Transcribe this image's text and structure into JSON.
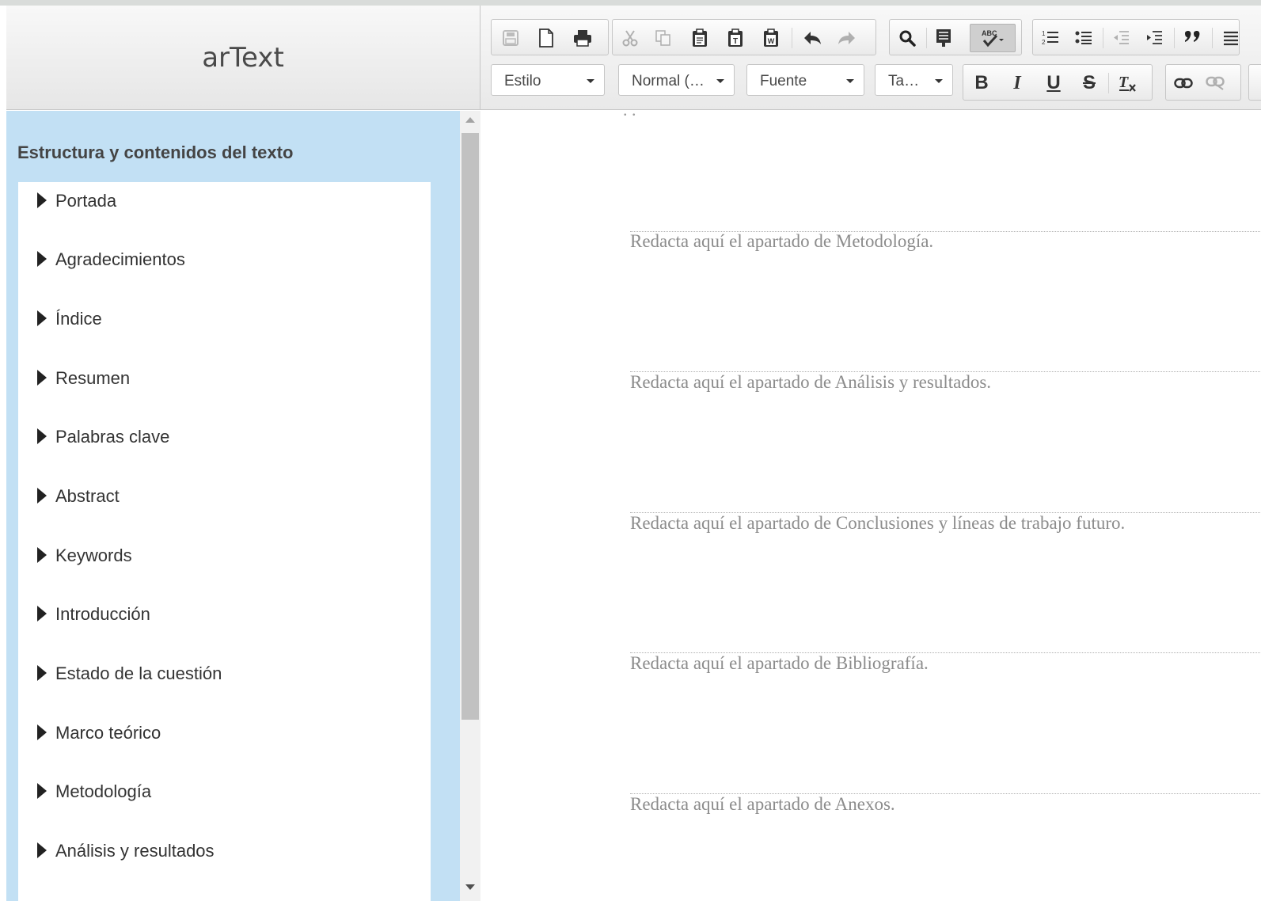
{
  "app": {
    "title": "arText"
  },
  "sidebar": {
    "heading": "Estructura y contenidos del texto",
    "items": [
      {
        "label": "Portada"
      },
      {
        "label": "Agradecimientos"
      },
      {
        "label": "Índice"
      },
      {
        "label": "Resumen"
      },
      {
        "label": "Palabras clave"
      },
      {
        "label": "Abstract"
      },
      {
        "label": "Keywords"
      },
      {
        "label": "Introducción"
      },
      {
        "label": "Estado de la cuestión"
      },
      {
        "label": "Marco teórico"
      },
      {
        "label": "Metodología"
      },
      {
        "label": "Análisis y resultados"
      }
    ]
  },
  "toolbar": {
    "row1_icons": [
      "save-icon",
      "new-page-icon",
      "print-icon",
      "cut-icon",
      "copy-icon",
      "paste-icon",
      "paste-text-icon",
      "paste-word-icon",
      "undo-icon",
      "redo-icon",
      "find-icon",
      "select-all-icon",
      "spellcheck-icon",
      "numbered-list-icon",
      "bulleted-list-icon",
      "outdent-icon",
      "indent-icon",
      "blockquote-icon",
      "align-icon"
    ],
    "style_combo": "Estilo",
    "format_combo": "Normal (…",
    "font_combo": "Fuente",
    "size_combo": "Ta…",
    "bold": "B",
    "italic": "I",
    "underline": "U",
    "strike": "S",
    "spellcheck_label": "ABC"
  },
  "editor": {
    "placeholders": [
      "Redacta aquí el apartado de Metodología.",
      "Redacta aquí el apartado de Análisis y resultados.",
      "Redacta aquí el apartado de Conclusiones y líneas de trabajo futuro.",
      "Redacta aquí el apartado de Bibliografía.",
      "Redacta aquí el apartado de Anexos."
    ]
  }
}
